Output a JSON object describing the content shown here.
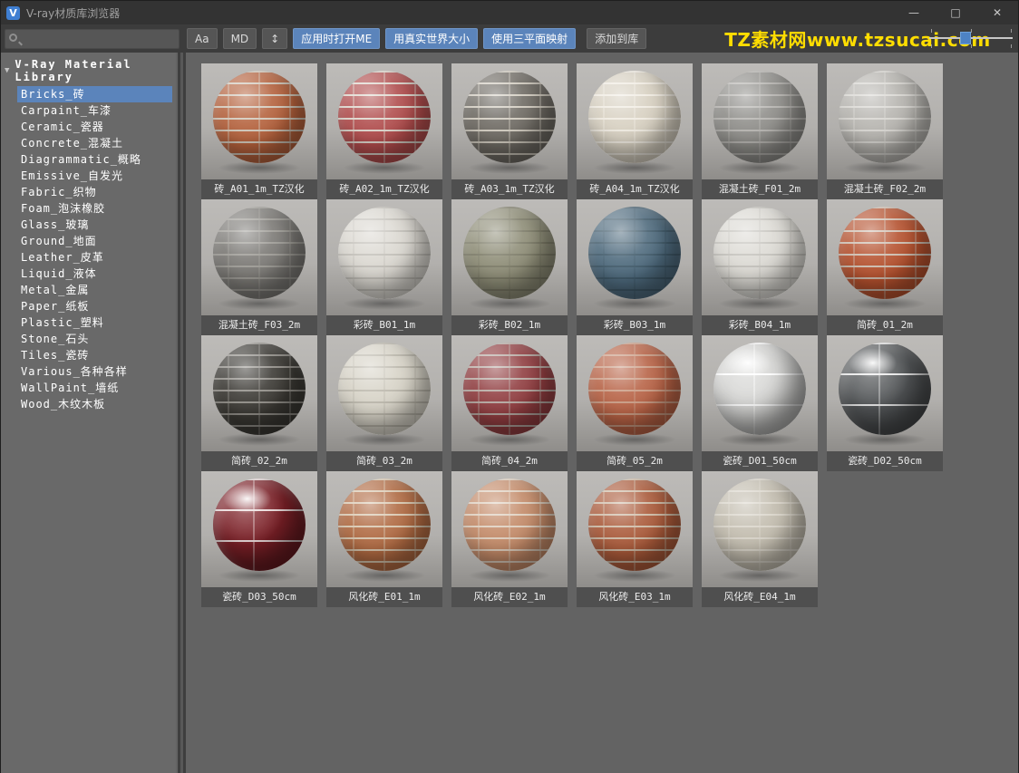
{
  "window": {
    "title": "V-ray材质库浏览器",
    "logo_letter": "V",
    "controls": {
      "minimize": "—",
      "maximize": "□",
      "close": "✕"
    }
  },
  "toolbar": {
    "search": {
      "placeholder": ""
    },
    "buttons": [
      {
        "label": "Aa",
        "style": "gray",
        "name": "match-case-button"
      },
      {
        "label": "MD",
        "style": "gray",
        "name": "md-filter-button"
      },
      {
        "label": "↕",
        "style": "gray",
        "name": "sort-direction-button"
      },
      {
        "label": "应用时打开ME",
        "style": "blue",
        "name": "open-me-on-apply-button"
      },
      {
        "label": "用真实世界大小",
        "style": "blue",
        "name": "real-world-size-button"
      },
      {
        "label": "使用三平面映射",
        "style": "blue",
        "name": "triplanar-mapping-button"
      },
      {
        "label": "添加到库",
        "style": "gray gap-before",
        "name": "add-to-library-button"
      }
    ],
    "watermark": "TZ素材网www.tzsucai.com",
    "slider": {
      "position_percent": 37
    }
  },
  "sidebar": {
    "root_label": "V-Ray Material Library",
    "items": [
      {
        "label": "Bricks_砖",
        "selected": true
      },
      {
        "label": "Carpaint_车漆",
        "selected": false
      },
      {
        "label": "Ceramic_瓷器",
        "selected": false
      },
      {
        "label": "Concrete_混凝土",
        "selected": false
      },
      {
        "label": "Diagrammatic_概略",
        "selected": false
      },
      {
        "label": "Emissive_自发光",
        "selected": false
      },
      {
        "label": "Fabric_织物",
        "selected": false
      },
      {
        "label": "Foam_泡沫橡胶",
        "selected": false
      },
      {
        "label": "Glass_玻璃",
        "selected": false
      },
      {
        "label": "Ground_地面",
        "selected": false
      },
      {
        "label": "Leather_皮革",
        "selected": false
      },
      {
        "label": "Liquid_液体",
        "selected": false
      },
      {
        "label": "Metal_金属",
        "selected": false
      },
      {
        "label": "Paper_纸板",
        "selected": false
      },
      {
        "label": "Plastic_塑料",
        "selected": false
      },
      {
        "label": "Stone_石头",
        "selected": false
      },
      {
        "label": "Tiles_瓷砖",
        "selected": false
      },
      {
        "label": "Various_各种各样",
        "selected": false
      },
      {
        "label": "WallPaint_墙纸",
        "selected": false
      },
      {
        "label": "Wood_木纹木板",
        "selected": false
      }
    ]
  },
  "materials": [
    {
      "label": "砖_A01_1m_TZ汉化",
      "base": "#b4613c",
      "mortar": "#d0c6b8",
      "type": "brick"
    },
    {
      "label": "砖_A02_1m_TZ汉化",
      "base": "#b04c4c",
      "mortar": "#dcd4ca",
      "type": "brick"
    },
    {
      "label": "砖_A03_1m_TZ汉化",
      "base": "#6e6a63",
      "mortar": "#cfc9bd",
      "type": "brick"
    },
    {
      "label": "砖_A04_1m_TZ汉化",
      "base": "#d7d0c1",
      "mortar": "#efeae0",
      "type": "brick"
    },
    {
      "label": "混凝土砖_F01_2m",
      "base": "#8e8d89",
      "mortar": "#b4b2ae",
      "type": "brick"
    },
    {
      "label": "混凝土砖_F02_2m",
      "base": "#b6b4af",
      "mortar": "#d6d4cf",
      "type": "brick"
    },
    {
      "label": "混凝土砖_F03_2m",
      "base": "#7b7975",
      "mortar": "#9c9a94",
      "type": "brick"
    },
    {
      "label": "彩砖_B01_1m",
      "base": "#dbd8d1",
      "mortar": "#c2bfb8",
      "type": "brick"
    },
    {
      "label": "彩砖_B02_1m",
      "base": "#8e8d77",
      "mortar": "#7b7a66",
      "type": "brick"
    },
    {
      "label": "彩砖_B03_1m",
      "base": "#4e6a7d",
      "mortar": "#405a6a",
      "type": "brick"
    },
    {
      "label": "彩砖_B04_1m",
      "base": "#dcdad4",
      "mortar": "#c3c1bb",
      "type": "brick"
    },
    {
      "label": "简砖_01_2m",
      "base": "#b5512e",
      "mortar": "#cdbcae",
      "type": "brick"
    },
    {
      "label": "简砖_02_2m",
      "base": "#3a3833",
      "mortar": "#8d8a84",
      "type": "brick"
    },
    {
      "label": "简砖_03_2m",
      "base": "#d7d3c7",
      "mortar": "#bab6aa",
      "type": "brick"
    },
    {
      "label": "简砖_04_2m",
      "base": "#903d40",
      "mortar": "#b5a7a0",
      "type": "brick"
    },
    {
      "label": "简砖_05_2m",
      "base": "#b76245",
      "mortar": "#c99a82",
      "type": "brick"
    },
    {
      "label": "瓷砖_D01_50cm",
      "base": "#d8d8d6",
      "mortar": "#ffffff",
      "type": "tile"
    },
    {
      "label": "瓷砖_D02_50cm",
      "base": "#55585a",
      "mortar": "#e9e9e9",
      "type": "tile"
    },
    {
      "label": "瓷砖_D03_50cm",
      "base": "#7c2027",
      "mortar": "#ead9d9",
      "type": "tile"
    },
    {
      "label": "风化砖_E01_1m",
      "base": "#b06a42",
      "mortar": "#d8c6ae",
      "type": "brick"
    },
    {
      "label": "风化砖_E02_1m",
      "base": "#c38a68",
      "mortar": "#ddcdbc",
      "type": "brick"
    },
    {
      "label": "风化砖_E03_1m",
      "base": "#aa5a3a",
      "mortar": "#cdb9a4",
      "type": "brick"
    },
    {
      "label": "风化砖_E04_1m",
      "base": "#c2bcae",
      "mortar": "#d8d3c8",
      "type": "brick"
    }
  ],
  "colors": {
    "accent_blue": "#5b84bb",
    "watermark_yellow": "#ffdd00",
    "titlebar_bg": "#333333",
    "toolbar_bg": "#3c3c3c",
    "sidebar_bg": "#696969",
    "main_bg": "#636363"
  }
}
